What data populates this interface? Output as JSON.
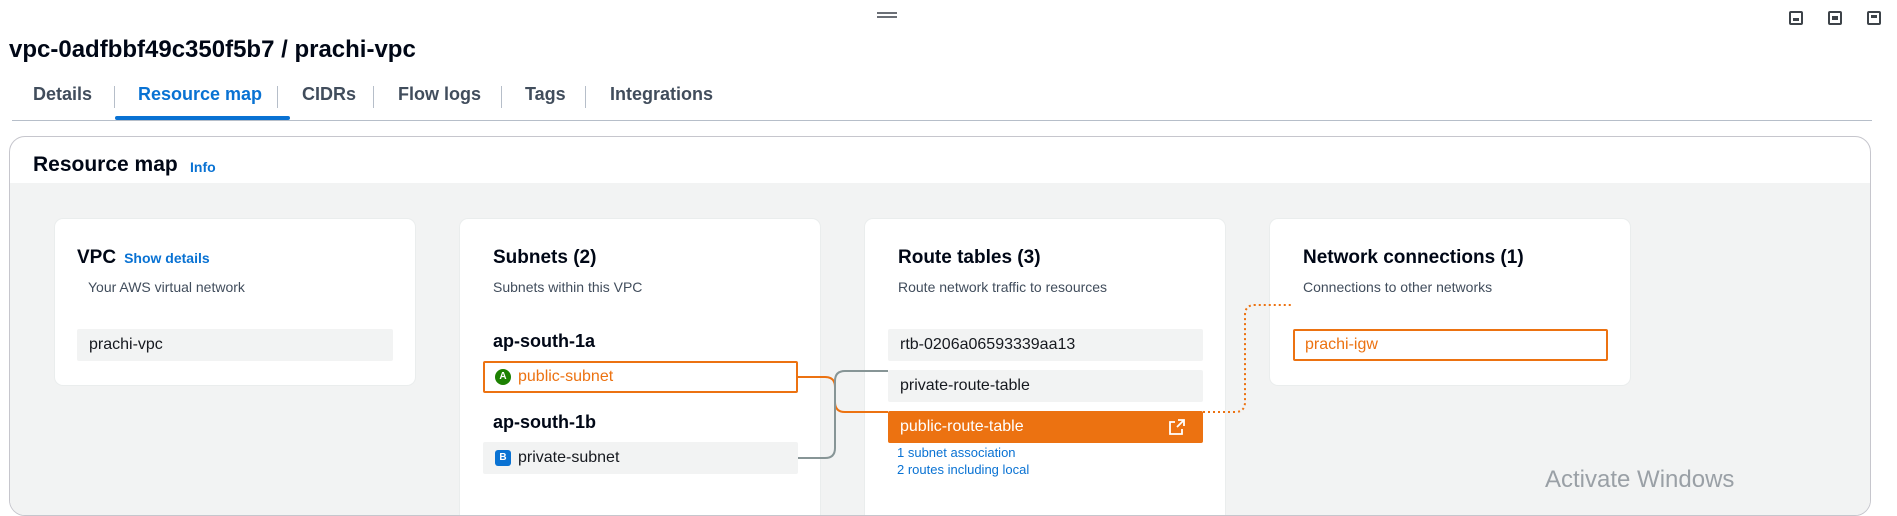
{
  "page": {
    "title": "vpc-0adfbbf49c350f5b7 / prachi-vpc"
  },
  "tabs": [
    {
      "label": "Details"
    },
    {
      "label": "Resource map"
    },
    {
      "label": "CIDRs"
    },
    {
      "label": "Flow logs"
    },
    {
      "label": "Tags"
    },
    {
      "label": "Integrations"
    }
  ],
  "active_tab": "Resource map",
  "resource_map": {
    "title": "Resource map",
    "info_label": "Info",
    "vpc": {
      "title": "VPC",
      "show_details": "Show details",
      "description": "Your AWS virtual network",
      "name": "prachi-vpc"
    },
    "subnets": {
      "title": "Subnets (2)",
      "description": "Subnets within this VPC",
      "zones": [
        {
          "name": "ap-south-1a",
          "subnet": "public-subnet",
          "badge": "A"
        },
        {
          "name": "ap-south-1b",
          "subnet": "private-subnet",
          "badge": "B"
        }
      ]
    },
    "route_tables": {
      "title": "Route tables (3)",
      "description": "Route network traffic to resources",
      "items": [
        {
          "name": "rtb-0206a06593339aa13"
        },
        {
          "name": "private-route-table"
        },
        {
          "name": "public-route-table"
        }
      ],
      "selected_details": {
        "associations": "1 subnet association",
        "routes": "2 routes including local"
      }
    },
    "network_connections": {
      "title": "Network connections (1)",
      "description": "Connections to other networks",
      "items": [
        {
          "name": "prachi-igw"
        }
      ]
    }
  },
  "watermark": "Activate Windows",
  "colors": {
    "accent": "#0972d3",
    "highlight": "#ec7211",
    "connector_gray": "#879596"
  },
  "icons": [
    "drag-handle-icon",
    "minimize-panel-icon",
    "split-panel-icon",
    "maximize-panel-icon",
    "external-link-icon"
  ]
}
